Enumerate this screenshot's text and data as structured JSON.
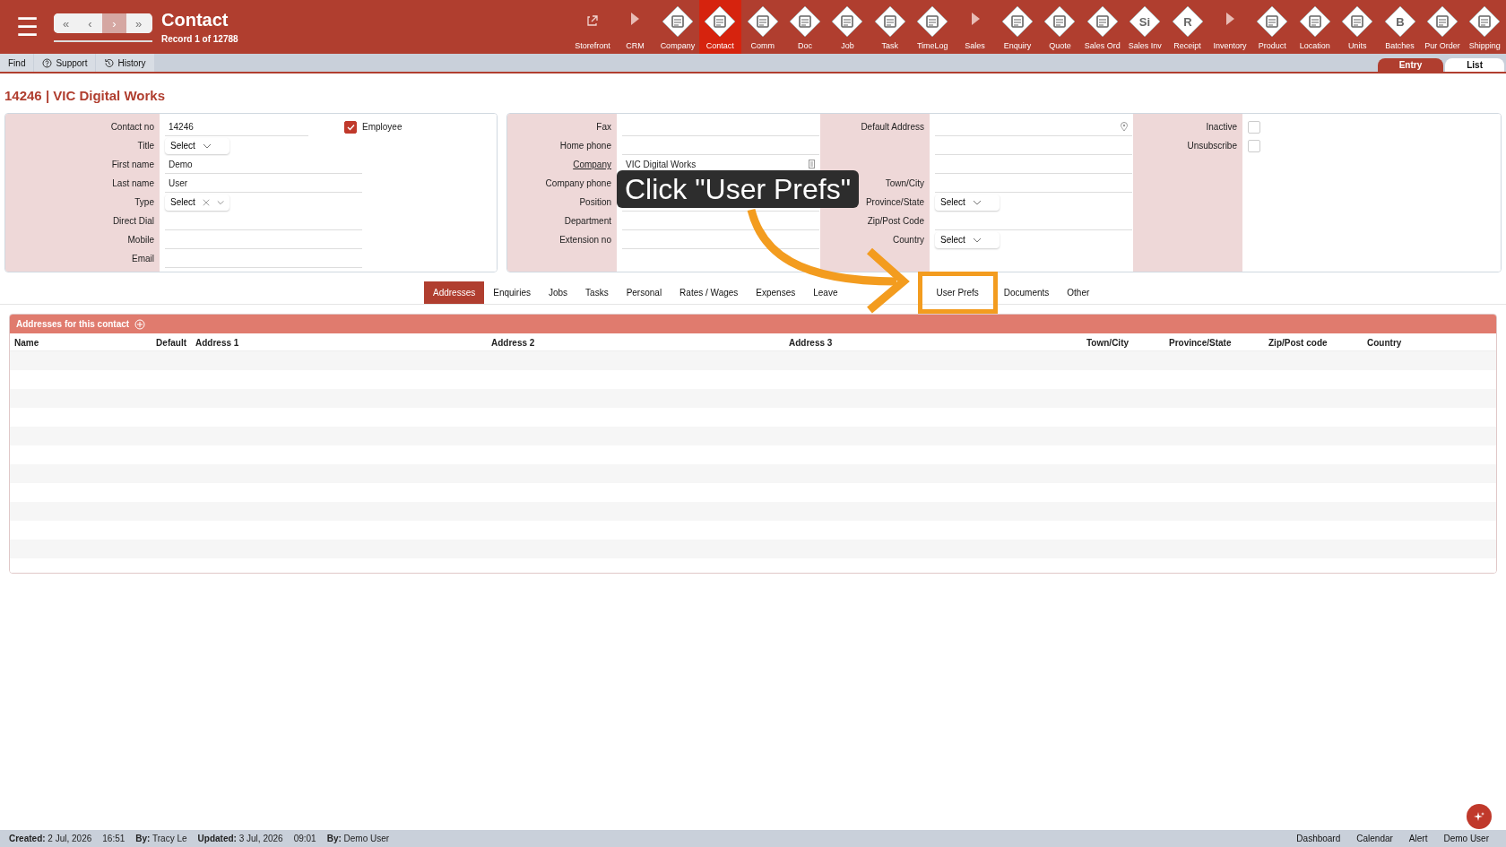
{
  "header": {
    "menu": "☰",
    "nav_buttons": [
      {
        "label": "«",
        "highlighted": false
      },
      {
        "label": "‹",
        "highlighted": false
      },
      {
        "label": "›",
        "highlighted": true
      },
      {
        "label": "»",
        "highlighted": false
      }
    ],
    "title": "Contact",
    "subtitle": "Record 1 of 12788",
    "modules": [
      {
        "label": "Storefront",
        "kind": "link",
        "selected": false
      },
      {
        "label": "CRM",
        "kind": "section",
        "selected": false
      },
      {
        "label": "Company",
        "kind": "module",
        "selected": false
      },
      {
        "label": "Contact",
        "kind": "module",
        "selected": true
      },
      {
        "label": "Comm",
        "kind": "module",
        "selected": false
      },
      {
        "label": "Doc",
        "kind": "module",
        "selected": false
      },
      {
        "label": "Job",
        "kind": "module",
        "selected": false
      },
      {
        "label": "Task",
        "kind": "module",
        "selected": false
      },
      {
        "label": "TimeLog",
        "kind": "module",
        "selected": false
      },
      {
        "label": "Sales",
        "kind": "section",
        "selected": false
      },
      {
        "label": "Enquiry",
        "kind": "module",
        "selected": false
      },
      {
        "label": "Quote",
        "kind": "module",
        "selected": false
      },
      {
        "label": "Sales Ord",
        "kind": "module",
        "selected": false
      },
      {
        "label": "Sales Inv",
        "kind": "module",
        "selected": false,
        "glyph": "Si"
      },
      {
        "label": "Receipt",
        "kind": "module",
        "selected": false,
        "glyph": "R"
      },
      {
        "label": "Inventory",
        "kind": "section",
        "selected": false
      },
      {
        "label": "Product",
        "kind": "module",
        "selected": false
      },
      {
        "label": "Location",
        "kind": "module",
        "selected": false
      },
      {
        "label": "Units",
        "kind": "module",
        "selected": false
      },
      {
        "label": "Batches",
        "kind": "module",
        "selected": false,
        "glyph": "B"
      },
      {
        "label": "Pur Order",
        "kind": "module",
        "selected": false
      },
      {
        "label": "Shipping",
        "kind": "module",
        "selected": false
      }
    ]
  },
  "toolbar": {
    "items": [
      {
        "label": "Find",
        "kind": "plain"
      },
      {
        "label": "Support",
        "kind": "help"
      },
      {
        "label": "History",
        "kind": "history"
      }
    ],
    "views": [
      {
        "label": "Entry",
        "selected": true
      },
      {
        "label": "List",
        "selected": false
      }
    ]
  },
  "record_title": "14246 | VIC Digital Works",
  "panels": [
    {
      "fields": [
        {
          "label": "Contact no",
          "kind": "text",
          "value": "14246",
          "checkbox": {
            "label": "Employee",
            "checked": true
          }
        },
        {
          "label": "Title",
          "kind": "select",
          "value": "Select",
          "clearable": false
        },
        {
          "label": "First name",
          "kind": "text",
          "value": "Demo"
        },
        {
          "label": "Last name",
          "kind": "text",
          "value": "User"
        },
        {
          "label": "Type",
          "kind": "select",
          "value": "Select",
          "clearable": true
        },
        {
          "label": "Direct Dial",
          "kind": "text"
        },
        {
          "label": "Mobile",
          "kind": "text"
        },
        {
          "label": "Email",
          "kind": "text"
        }
      ]
    },
    {
      "columns": [
        {
          "fields": [
            {
              "label": "Fax",
              "kind": "text"
            },
            {
              "label": "Home phone",
              "kind": "text"
            },
            {
              "label": "Company",
              "kind": "lookup",
              "value": "VIC Digital Works",
              "link": true
            },
            {
              "label": "Company phone",
              "kind": "text"
            },
            {
              "label": "Position",
              "kind": "text"
            },
            {
              "label": "Department",
              "kind": "text"
            },
            {
              "label": "Extension no",
              "kind": "text"
            }
          ]
        },
        {
          "fields": [
            {
              "label": "Default Address",
              "kind": "address"
            },
            {
              "kind": "text"
            },
            {
              "kind": "text"
            },
            {
              "label": "Town/City",
              "kind": "text"
            },
            {
              "label": "Province/State",
              "kind": "select",
              "value": "Select",
              "clearable": false
            },
            {
              "label": "Zip/Post Code",
              "kind": "text"
            },
            {
              "label": "Country",
              "kind": "select",
              "value": "Select",
              "clearable": false
            }
          ]
        },
        {
          "fields": [
            {
              "label": "Inactive",
              "kind": "checkbox",
              "checked": false
            },
            {
              "label": "Unsubscribe",
              "kind": "checkbox",
              "checked": false
            }
          ]
        }
      ]
    }
  ],
  "tabs": [
    {
      "label": "Addresses",
      "selected": true
    },
    {
      "label": "Enquiries",
      "selected": false
    },
    {
      "label": "Jobs",
      "selected": false
    },
    {
      "label": "Tasks",
      "selected": false
    },
    {
      "label": "Personal",
      "selected": false
    },
    {
      "label": "Rates / Wages",
      "selected": false
    },
    {
      "label": "Expenses",
      "selected": false
    },
    {
      "label": "Leave",
      "selected": false
    },
    {
      "label": "User Prefs",
      "selected": false,
      "highlighted": true
    },
    {
      "label": "Documents",
      "selected": false
    },
    {
      "label": "Other",
      "selected": false
    }
  ],
  "table": {
    "title": "Addresses for this contact",
    "columns": [
      "Name",
      "Default",
      "Address 1",
      "Address 2",
      "Address 3",
      "Town/City",
      "Province/State",
      "Zip/Post code",
      "Country"
    ]
  },
  "annotation": {
    "text": "Click \"User Prefs\""
  },
  "status_bar": {
    "items": [
      "**Created:** 2 Jul, 2026",
      "16:51",
      "**By:** Tracy Le",
      "**Updated:** 3 Jul, 2026",
      "09:01",
      "**By:** Demo User"
    ],
    "links": [
      "Dashboard",
      "Calendar",
      "Alert",
      "Demo User"
    ]
  }
}
